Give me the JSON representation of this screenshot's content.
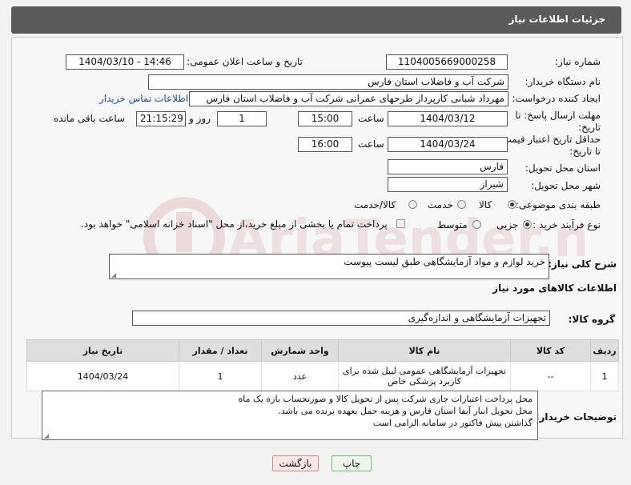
{
  "header": {
    "title": "جزئیات اطلاعات نیاز"
  },
  "form": {
    "need_number": {
      "label": "شماره نیاز:",
      "value": "1104005669000258"
    },
    "announce_datetime": {
      "label": "تاریخ و ساعت اعلان عمومی:",
      "value": "1404/03/10 - 14:46"
    },
    "buyer_org": {
      "label": "نام دستگاه خریدار:",
      "value": "شرکت آب و فاضلاب استان فارس"
    },
    "requester": {
      "label": "ایجاد کننده درخواست:",
      "value": "مهرداد شبانی کارپرداز طرحهای عمرانی  شرکت آب و فاضلاب استان فارس",
      "contact_link": "اطلاعات تماس خریدار"
    },
    "deadline": {
      "label_line1": "مهلت ارسال پاسخ: تا",
      "label_line2": "تاریخ:",
      "date": "1404/03/12",
      "time_label": "ساعت",
      "time": "15:00",
      "days": "1",
      "days_label": "روز و",
      "remaining": "21:15:29",
      "remaining_label": "ساعت باقی مانده"
    },
    "min_validity": {
      "label_line1": "حداقل تاریخ اعتبار قیمت:",
      "label_line2": "تا تاریخ:",
      "date": "1404/03/24",
      "time_label": "ساعت",
      "time": "16:00"
    },
    "delivery_province": {
      "label": "استان محل تحویل:",
      "value": "فارس"
    },
    "delivery_city": {
      "label": "شهر محل تحویل:",
      "value": "شیراز"
    },
    "category": {
      "label": "طبقه بندی موضوعی:",
      "options": [
        "کالا",
        "خدمت",
        "کالا/خدمت"
      ],
      "selected": "کالا"
    },
    "process_type": {
      "label": "نوع فرآیند خرید :",
      "options": [
        "جزیی",
        "متوسط"
      ],
      "selected": "جزیی",
      "note": "پرداخت تمام یا بخشی از مبلغ خرید،از محل \"اسناد خزانه اسلامی\" خواهد بود."
    }
  },
  "description": {
    "label": "شرح کلی نیاز:",
    "value": "خرید لوازم و مواد آزمایشگاهی طبق لیست پیوست"
  },
  "goods": {
    "section_title": "اطلاعات کالاهای مورد نیاز",
    "group_label": "گروه کالا:",
    "group_value": "تجهیزات آزمایشگاهی و اندازه‌گیری",
    "columns": [
      "ردیف",
      "کد کالا",
      "نام کالا",
      "واحد شمارش",
      "تعداد / مقدار",
      "تاریخ نیاز"
    ],
    "rows": [
      {
        "row": "1",
        "code": "--",
        "name": "تجهیزات آزمایشگاهی عمومی لیبل شده برای کاربرد پزشکی خاص",
        "unit": "عدد",
        "qty": "1",
        "date": "1404/03/24"
      }
    ]
  },
  "buyer_notes": {
    "label": "توضیحات خریدار:",
    "lines": [
      "محل پرداخت اعتبارات جاری شرکت پس از تحویل کالا و صورتحساب بازه یک ماه",
      "محل تحویل انبار آبفا استان فارس و هزینه حمل بعهده برنده می باشد.",
      "گذاشتن پیش فاکتور در سامانه الزامی است"
    ]
  },
  "buttons": {
    "print": "چاپ",
    "back": "بازگشت"
  },
  "watermark": {
    "text": "AriaTender.net"
  },
  "colors": {
    "header_bg": "#5a5a5a",
    "link": "#1a4fa0",
    "watermark": "#e9c9c9"
  }
}
